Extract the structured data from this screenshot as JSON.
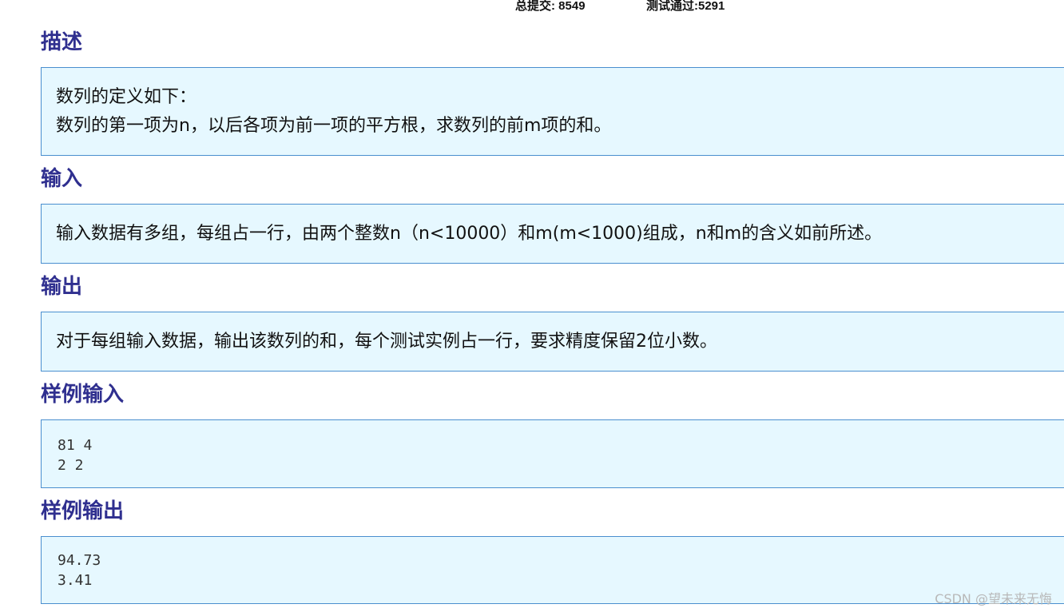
{
  "stats": {
    "total_submissions": "总提交: 8549",
    "test_passed": "测试通过:5291"
  },
  "description": {
    "title": "描述",
    "lines": [
      "数列的定义如下：",
      "数列的第一项为n，以后各项为前一项的平方根，求数列的前m项的和。"
    ]
  },
  "input": {
    "title": "输入",
    "text": "输入数据有多组，每组占一行，由两个整数n（n<10000）和m(m<1000)组成，n和m的含义如前所述。"
  },
  "output": {
    "title": "输出",
    "text": "对于每组输入数据，输出该数列的和，每个测试实例占一行，要求精度保留2位小数。"
  },
  "sample_input": {
    "title": "样例输入",
    "lines": [
      "81 4",
      "2 2"
    ]
  },
  "sample_output": {
    "title": "样例输出",
    "lines": [
      "94.73",
      "3.41"
    ]
  },
  "watermark": "CSDN @望未来无悔"
}
